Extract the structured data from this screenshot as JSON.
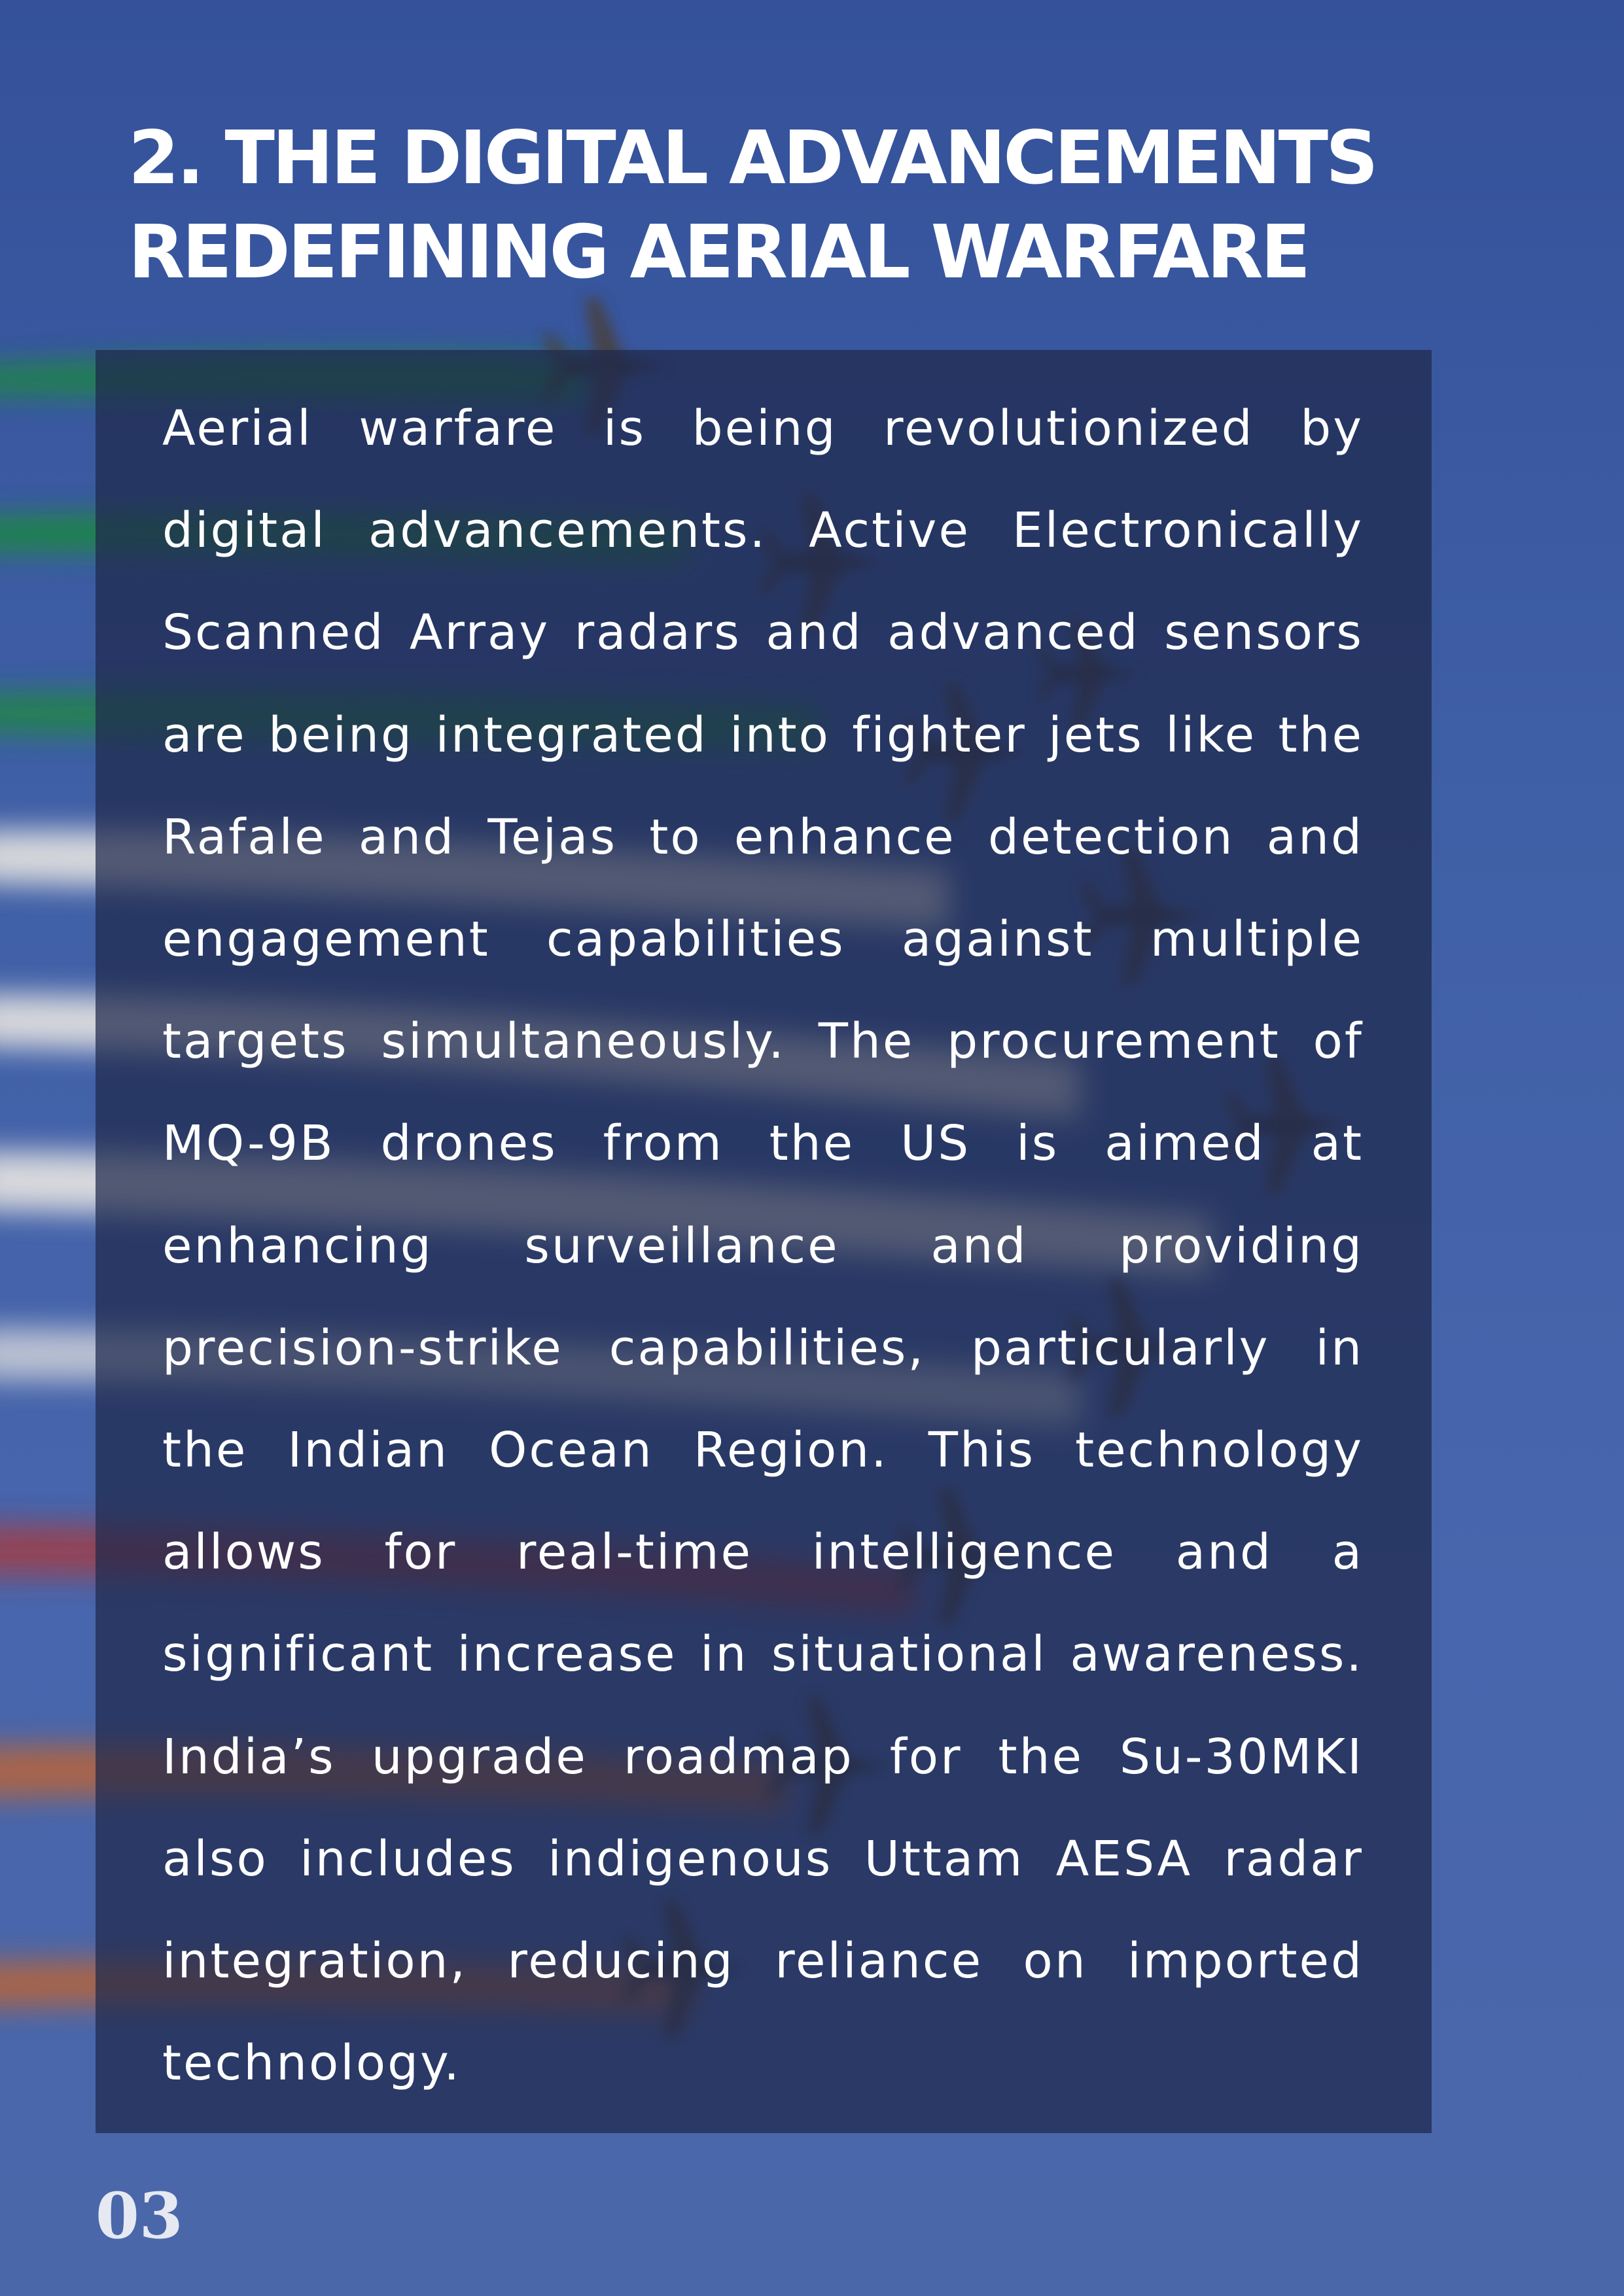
{
  "document": {
    "heading": "2. THE DIGITAL ADVANCEMENTS REDEFINING AERIAL WARFARE",
    "body": "Aerial warfare is being revolutionized by digital advancements. Active Electronically Scanned Array radars and advanced sensors are being integrated into fighter jets like the Rafale and Tejas to enhance detection and engagement capabilities against multiple targets simultaneously. The procurement of MQ-9B drones from the US is aimed at enhancing surveillance and providing precision-strike capabilities, particularly in the Indian Ocean Region. This technology allows for real-time intelligence and a significant increase in situational awareness.  India’s upgrade roadmap for the Su-30MKI also includes indigenous Uttam AESA radar integration, reducing reliance on imported technology.",
    "page_number": "03"
  },
  "background": {
    "image": "fighter-jets-formation-tricolour-smoke",
    "colors": {
      "sky": "#3f5fa6",
      "panel_overlay": "#1e284b",
      "smoke_green": "#1e8a3e",
      "smoke_white": "#e9e6e2",
      "smoke_orange": "#c8642a",
      "text": "#ffffff"
    }
  }
}
